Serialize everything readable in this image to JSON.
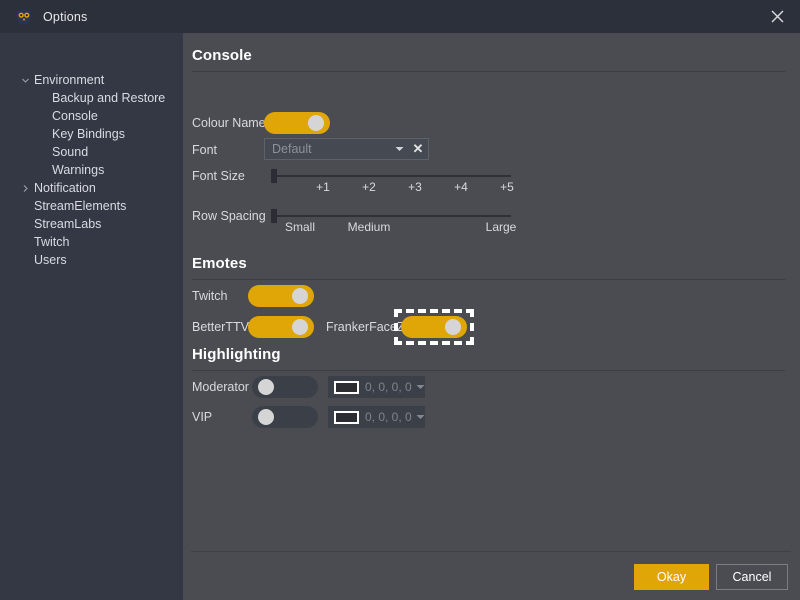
{
  "window": {
    "title": "Options",
    "icon": "app-owl-icon",
    "close_icon": "close-icon"
  },
  "sidebar": {
    "items": [
      {
        "label": "Environment",
        "level": 0,
        "chevron": "chevron-down",
        "name": "sidebar-item-environment"
      },
      {
        "label": "Backup and Restore",
        "level": 1,
        "chevron": "",
        "name": "sidebar-item-backup-and-restore"
      },
      {
        "label": "Console",
        "level": 1,
        "chevron": "",
        "name": "sidebar-item-console"
      },
      {
        "label": "Key Bindings",
        "level": 1,
        "chevron": "",
        "name": "sidebar-item-key-bindings"
      },
      {
        "label": "Sound",
        "level": 1,
        "chevron": "",
        "name": "sidebar-item-sound"
      },
      {
        "label": "Warnings",
        "level": 1,
        "chevron": "",
        "name": "sidebar-item-warnings"
      },
      {
        "label": "Notification",
        "level": 0,
        "chevron": "chevron-right",
        "name": "sidebar-item-notification"
      },
      {
        "label": "StreamElements",
        "level": 0,
        "chevron": "",
        "name": "sidebar-item-streamelements"
      },
      {
        "label": "StreamLabs",
        "level": 0,
        "chevron": "",
        "name": "sidebar-item-streamlabs"
      },
      {
        "label": "Twitch",
        "level": 0,
        "chevron": "",
        "name": "sidebar-item-twitch"
      },
      {
        "label": "Users",
        "level": 0,
        "chevron": "",
        "name": "sidebar-item-users"
      }
    ]
  },
  "console": {
    "heading": "Console",
    "colour_names": {
      "label": "Colour Names",
      "state": "on"
    },
    "font": {
      "label": "Font",
      "value": "Default",
      "clear_icon": "x-icon",
      "arrow_icon": "chevron-down-icon"
    },
    "font_size": {
      "label": "Font Size",
      "ticks": [
        "+1",
        "+2",
        "+3",
        "+4",
        "+5"
      ],
      "value": 0
    },
    "row_spacing": {
      "label": "Row Spacing",
      "ticks": [
        "Small",
        "Medium",
        "Large"
      ],
      "value": 0
    }
  },
  "emotes": {
    "heading": "Emotes",
    "twitch": {
      "label": "Twitch",
      "state": "on"
    },
    "betterttv": {
      "label": "BetterTTV",
      "state": "on"
    },
    "frankerfacez": {
      "label": "FrankerFaceZ",
      "state": "on",
      "focused": true
    }
  },
  "highlighting": {
    "heading": "Highlighting",
    "rows": [
      {
        "label": "Moderator",
        "state": "off",
        "colour": "0, 0, 0, 0"
      },
      {
        "label": "VIP",
        "state": "off",
        "colour": "0, 0, 0, 0"
      }
    ]
  },
  "footer": {
    "okay": "Okay",
    "cancel": "Cancel"
  },
  "colors": {
    "accent": "#e0a608",
    "sidebar_bg": "#343844",
    "panel_bg": "#4b4c52",
    "titlebar_bg": "#2c303a",
    "toggle_off": "#3b3f48",
    "knob": "#d5d5d5"
  }
}
